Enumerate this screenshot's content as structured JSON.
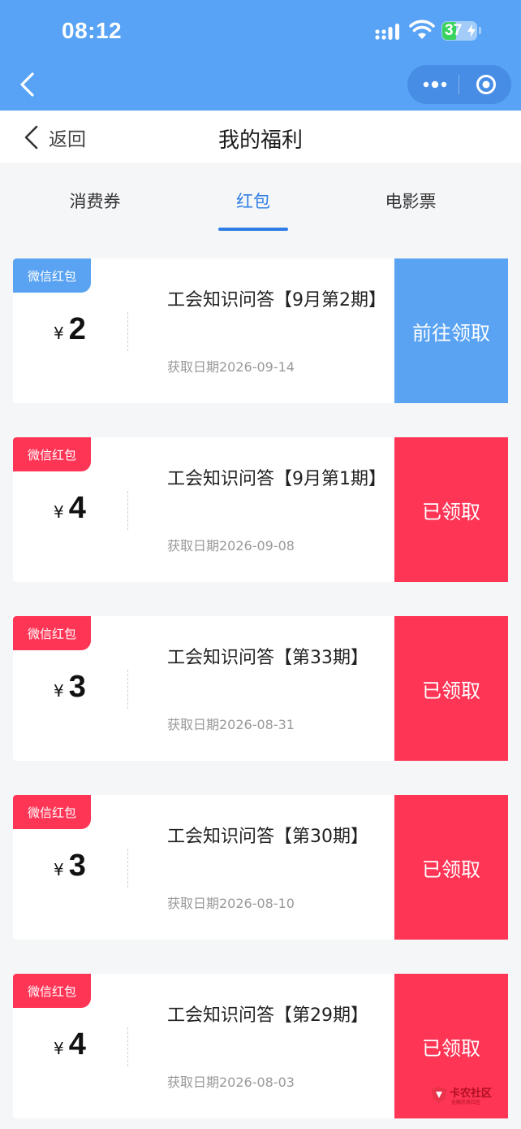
{
  "status_bar": {
    "time": "08:12",
    "battery": "37"
  },
  "header": {
    "back_label": "返回",
    "title": "我的福利"
  },
  "tabs": [
    {
      "label": "消费券",
      "active": false
    },
    {
      "label": "红包",
      "active": true
    },
    {
      "label": "电影票",
      "active": false
    }
  ],
  "currency_symbol": "¥",
  "coupons": [
    {
      "tag": "微信红包",
      "amount": "2",
      "title": "工会知识问答【9月第2期】",
      "date": "获取日期2026-09-14",
      "action": "前往领取",
      "state": "claimable",
      "color": "#59a3f2"
    },
    {
      "tag": "微信红包",
      "amount": "4",
      "title": "工会知识问答【9月第1期】",
      "date": "获取日期2026-09-08",
      "action": "已领取",
      "state": "claimed",
      "color": "#ff3556"
    },
    {
      "tag": "微信红包",
      "amount": "3",
      "title": "工会知识问答【第33期】",
      "date": "获取日期2026-08-31",
      "action": "已领取",
      "state": "claimed",
      "color": "#ff3556"
    },
    {
      "tag": "微信红包",
      "amount": "3",
      "title": "工会知识问答【第30期】",
      "date": "获取日期2026-08-10",
      "action": "已领取",
      "state": "claimed",
      "color": "#ff3556"
    },
    {
      "tag": "微信红包",
      "amount": "4",
      "title": "工会知识问答【第29期】",
      "date": "获取日期2026-08-03",
      "action": "已领取",
      "state": "claimed",
      "color": "#ff3556"
    }
  ],
  "watermark": {
    "name": "卡农社区",
    "subtitle": "金融信息社区"
  },
  "colors": {
    "top_bar": "#58a3f5",
    "tab_active": "#2f7ee6",
    "claimable": "#59a3f2",
    "claimed": "#ff3556"
  }
}
